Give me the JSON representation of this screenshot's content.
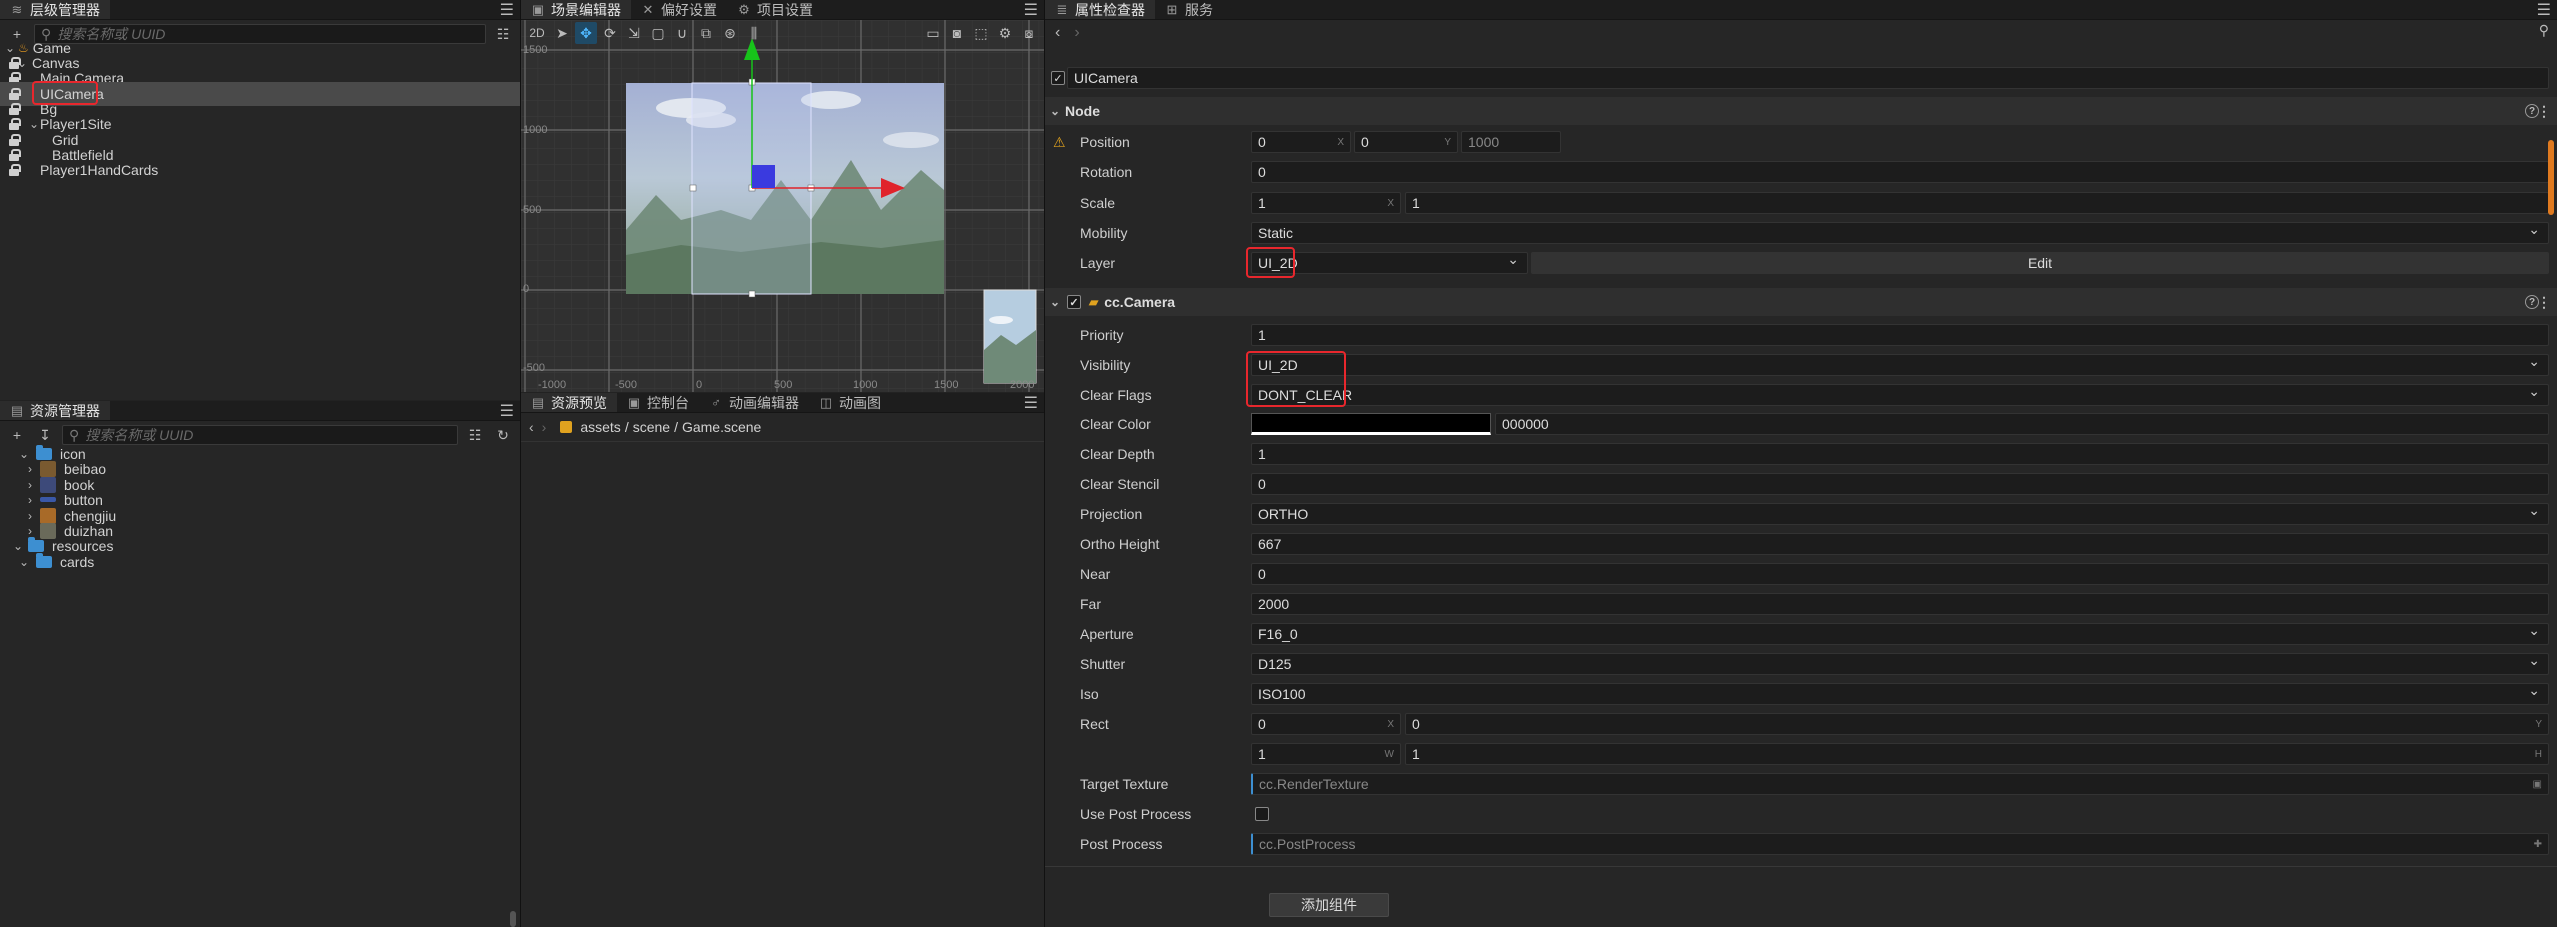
{
  "hierarchy": {
    "tab_label": "层级管理器",
    "search_placeholder": "搜索名称或 UUID",
    "nodes": [
      {
        "label": "Game"
      },
      {
        "label": "Canvas"
      },
      {
        "label": "Main Camera"
      },
      {
        "label": "UICamera"
      },
      {
        "label": "Bg"
      },
      {
        "label": "Player1Site"
      },
      {
        "label": "Grid"
      },
      {
        "label": "Battlefield"
      },
      {
        "label": "Player1HandCards"
      }
    ]
  },
  "scene": {
    "tabs": [
      {
        "label": "场景编辑器"
      },
      {
        "label": "偏好设置"
      },
      {
        "label": "项目设置"
      }
    ],
    "mode_2d": "2D",
    "y_ticks": [
      "1500",
      "1000",
      "500",
      "0",
      "-500"
    ],
    "x_ticks": [
      "-1000",
      "-500",
      "0",
      "500",
      "1000",
      "1500",
      "2000"
    ]
  },
  "bottom": {
    "tabs": [
      {
        "label": "资源预览"
      },
      {
        "label": "控制台"
      },
      {
        "label": "动画编辑器"
      },
      {
        "label": "动画图"
      }
    ],
    "path": [
      "assets",
      "scene",
      "Game.scene"
    ]
  },
  "assets": {
    "tab_label": "资源管理器",
    "search_placeholder": "搜索名称或 UUID",
    "items": [
      {
        "label": "icon"
      },
      {
        "label": "beibao"
      },
      {
        "label": "book"
      },
      {
        "label": "button"
      },
      {
        "label": "chengjiu"
      },
      {
        "label": "duizhan"
      },
      {
        "label": "resources"
      },
      {
        "label": "cards"
      }
    ]
  },
  "inspector": {
    "tabs": [
      {
        "label": "属性检查器"
      },
      {
        "label": "服务"
      }
    ],
    "node_name": "UICamera",
    "node_section": "Node",
    "position": {
      "label": "Position",
      "x": "0",
      "y": "0",
      "z": "1000"
    },
    "rotation": {
      "label": "Rotation",
      "value": "0"
    },
    "scale": {
      "label": "Scale",
      "x": "1",
      "y": "1"
    },
    "mobility": {
      "label": "Mobility",
      "value": "Static"
    },
    "layer": {
      "label": "Layer",
      "value": "UI_2D",
      "edit": "Edit"
    },
    "camera_section": "cc.Camera",
    "priority": {
      "label": "Priority",
      "value": "1"
    },
    "visibility": {
      "label": "Visibility",
      "value": "UI_2D"
    },
    "clear_flags": {
      "label": "Clear Flags",
      "value": "DONT_CLEAR"
    },
    "clear_color": {
      "label": "Clear Color",
      "value": "000000",
      "swatch": "#000000"
    },
    "clear_depth": {
      "label": "Clear Depth",
      "value": "1"
    },
    "clear_stencil": {
      "label": "Clear Stencil",
      "value": "0"
    },
    "projection": {
      "label": "Projection",
      "value": "ORTHO"
    },
    "ortho_height": {
      "label": "Ortho Height",
      "value": "667"
    },
    "near": {
      "label": "Near",
      "value": "0"
    },
    "far": {
      "label": "Far",
      "value": "2000"
    },
    "aperture": {
      "label": "Aperture",
      "value": "F16_0"
    },
    "shutter": {
      "label": "Shutter",
      "value": "D125"
    },
    "iso": {
      "label": "Iso",
      "value": "ISO100"
    },
    "rect": {
      "label": "Rect",
      "x": "0",
      "y": "0",
      "w": "1",
      "h": "1"
    },
    "target_texture": {
      "label": "Target Texture",
      "placeholder": "cc.RenderTexture"
    },
    "use_post_process": {
      "label": "Use Post Process"
    },
    "post_process": {
      "label": "Post Process",
      "placeholder": "cc.PostProcess"
    },
    "add_component": "添加组件"
  },
  "colors": {
    "accent": "#e8272d",
    "selection": "#4a4a4a",
    "move_x": "#e0232b",
    "move_y": "#17c41a",
    "move_z": "#3a3adf"
  }
}
